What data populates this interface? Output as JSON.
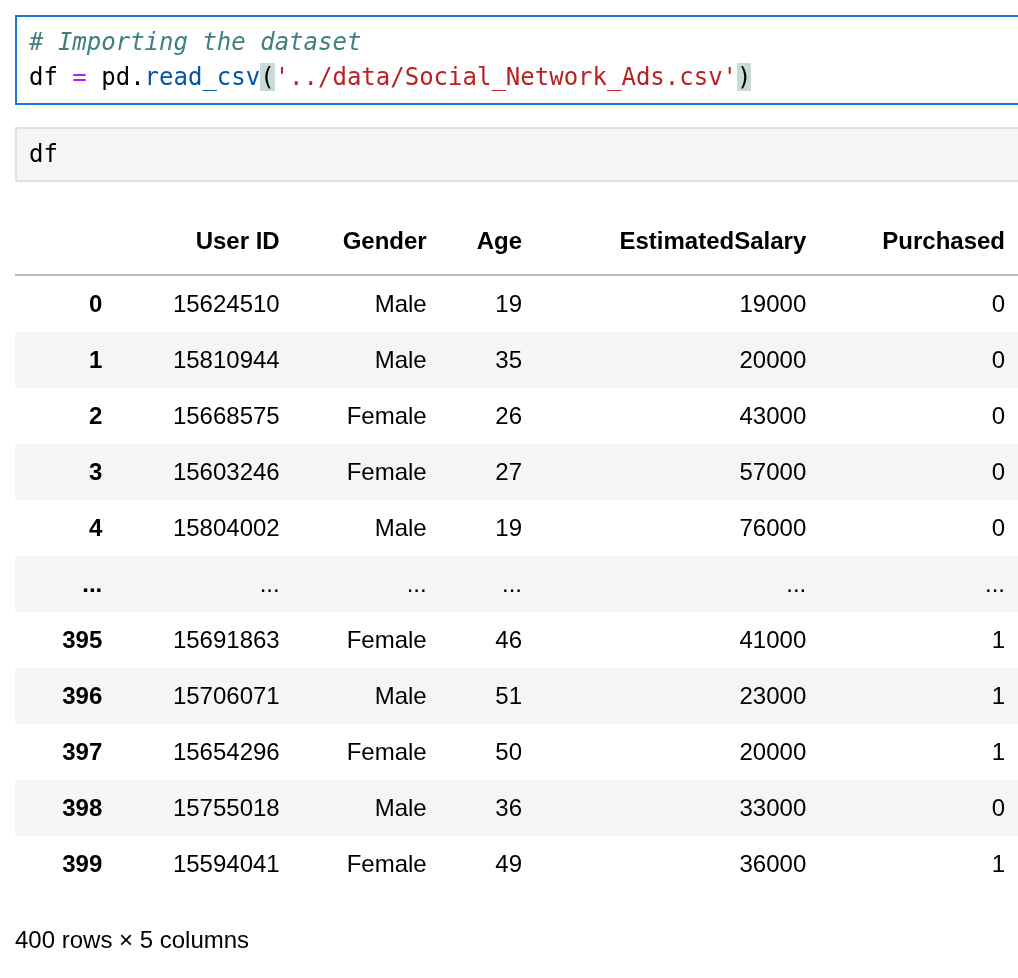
{
  "cells": [
    {
      "selected": true,
      "lines": [
        [
          {
            "kind": "comment",
            "text": "# Importing the dataset"
          }
        ],
        [
          {
            "kind": "name",
            "text": "df "
          },
          {
            "kind": "operator",
            "text": "="
          },
          {
            "kind": "name",
            "text": " pd."
          },
          {
            "kind": "function",
            "text": "read_csv"
          },
          {
            "kind": "bracket",
            "text": "(",
            "highlighted": true
          },
          {
            "kind": "string",
            "text": "'../data/Social_Network_Ads.csv'"
          },
          {
            "kind": "bracket",
            "text": ")",
            "highlighted": true
          }
        ]
      ]
    },
    {
      "selected": false,
      "lines": [
        [
          {
            "kind": "name",
            "text": "df"
          }
        ]
      ]
    }
  ],
  "table": {
    "columns": [
      "User ID",
      "Gender",
      "Age",
      "EstimatedSalary",
      "Purchased"
    ],
    "rows": [
      {
        "index": "0",
        "cells": [
          "15624510",
          "Male",
          "19",
          "19000",
          "0"
        ]
      },
      {
        "index": "1",
        "cells": [
          "15810944",
          "Male",
          "35",
          "20000",
          "0"
        ]
      },
      {
        "index": "2",
        "cells": [
          "15668575",
          "Female",
          "26",
          "43000",
          "0"
        ]
      },
      {
        "index": "3",
        "cells": [
          "15603246",
          "Female",
          "27",
          "57000",
          "0"
        ]
      },
      {
        "index": "4",
        "cells": [
          "15804002",
          "Male",
          "19",
          "76000",
          "0"
        ]
      },
      {
        "index": "...",
        "cells": [
          "...",
          "...",
          "...",
          "...",
          "..."
        ]
      },
      {
        "index": "395",
        "cells": [
          "15691863",
          "Female",
          "46",
          "41000",
          "1"
        ]
      },
      {
        "index": "396",
        "cells": [
          "15706071",
          "Male",
          "51",
          "23000",
          "1"
        ]
      },
      {
        "index": "397",
        "cells": [
          "15654296",
          "Female",
          "50",
          "20000",
          "1"
        ]
      },
      {
        "index": "398",
        "cells": [
          "15755018",
          "Male",
          "36",
          "33000",
          "0"
        ]
      },
      {
        "index": "399",
        "cells": [
          "15594041",
          "Female",
          "49",
          "36000",
          "1"
        ]
      }
    ]
  },
  "shape_note": "400 rows × 5 columns"
}
